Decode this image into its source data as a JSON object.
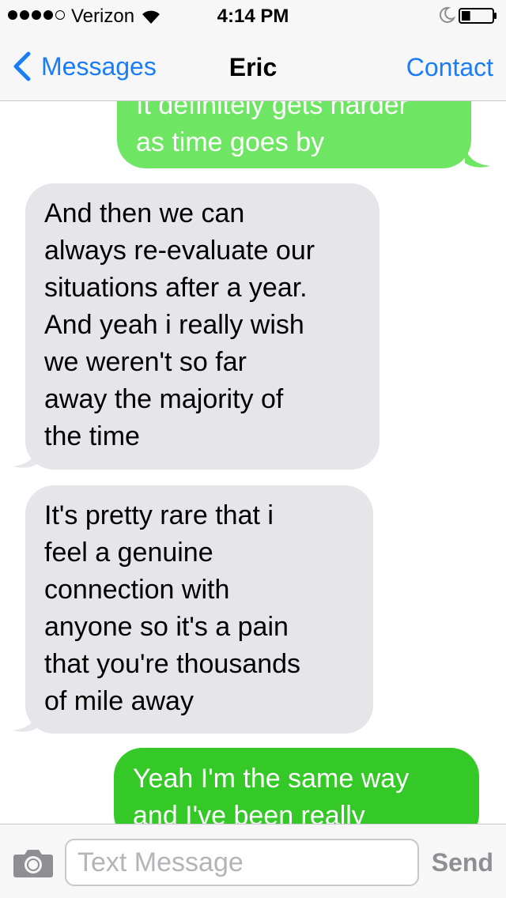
{
  "status": {
    "signal_bars_filled": 4,
    "signal_bars_total": 5,
    "carrier": "Verizon",
    "time": "4:14 PM",
    "battery_level": 0.28
  },
  "nav": {
    "back_label": "Messages",
    "title": "Eric",
    "action_label": "Contact"
  },
  "messages": [
    {
      "direction": "sent",
      "text": "It definitely gets harder\nas time goes by"
    },
    {
      "direction": "received",
      "text": "And then we can\nalways re-evaluate our\nsituations after a year.\nAnd yeah i really wish\nwe weren't so far\naway the majority of\nthe time"
    },
    {
      "direction": "received",
      "text": "It's pretty rare that i\nfeel a genuine\nconnection with\nanyone so it's a pain\nthat you're thousands\nof mile away"
    },
    {
      "direction": "sent",
      "text": "Yeah I'm the same way\nand I've been really"
    }
  ],
  "input": {
    "placeholder": "Text Message",
    "value": "",
    "send_label": "Send"
  },
  "colors": {
    "sent_bubble_light": "#6ee663",
    "sent_bubble": "#35c928",
    "received_bubble": "#e5e5ea",
    "accent": "#1a7cf6"
  }
}
